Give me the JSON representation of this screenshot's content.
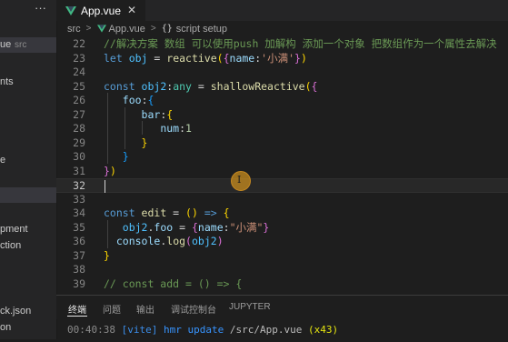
{
  "sidebar": {
    "menu_glyph": "···",
    "items": [
      {
        "label": "ue",
        "badge": "src"
      },
      {
        "label": "nts"
      },
      {
        "label": "e"
      },
      {
        "label": ""
      },
      {
        "label": "pment"
      },
      {
        "label": "ction"
      },
      {
        "label": "ck.json"
      },
      {
        "label": "on"
      }
    ]
  },
  "tab": {
    "label": "App.vue",
    "close_glyph": "✕",
    "icon": "vue-icon"
  },
  "breadcrumb": {
    "parts": [
      "src",
      "App.vue",
      "script setup"
    ],
    "separator": ">",
    "braces": "{}"
  },
  "editor": {
    "current_line": 32,
    "lines": [
      {
        "n": "22",
        "tokens": [
          [
            "cm",
            "//解决方案 数组 可以使用push 加解构 添加一个对象 把数组作为一个属性去解决"
          ]
        ]
      },
      {
        "n": "23",
        "tokens": [
          [
            "kw",
            "let "
          ],
          [
            "var",
            "obj"
          ],
          [
            "op",
            " = "
          ],
          [
            "fn",
            "reactive"
          ],
          [
            "b1",
            "("
          ],
          [
            "b2",
            "{"
          ],
          [
            "prop",
            "name"
          ],
          [
            "op",
            ":"
          ],
          [
            "str",
            "'小满'"
          ],
          [
            "b2",
            "}"
          ],
          [
            "b1",
            ")"
          ]
        ]
      },
      {
        "n": "24",
        "tokens": []
      },
      {
        "n": "25",
        "tokens": [
          [
            "kw",
            "const "
          ],
          [
            "var",
            "obj2"
          ],
          [
            "op",
            ":"
          ],
          [
            "type",
            "any"
          ],
          [
            "op",
            " = "
          ],
          [
            "fn",
            "shallowReactive"
          ],
          [
            "b1",
            "("
          ],
          [
            "b2",
            "{"
          ]
        ]
      },
      {
        "n": "26",
        "tokens": [
          [
            "op",
            "   "
          ],
          [
            "prop",
            "foo"
          ],
          [
            "op",
            ":"
          ],
          [
            "b3",
            "{"
          ]
        ]
      },
      {
        "n": "27",
        "tokens": [
          [
            "op",
            "      "
          ],
          [
            "prop",
            "bar"
          ],
          [
            "op",
            ":"
          ],
          [
            "b1",
            "{"
          ]
        ]
      },
      {
        "n": "28",
        "tokens": [
          [
            "op",
            "         "
          ],
          [
            "prop",
            "num"
          ],
          [
            "op",
            ":"
          ],
          [
            "num",
            "1"
          ]
        ]
      },
      {
        "n": "29",
        "tokens": [
          [
            "op",
            "      "
          ],
          [
            "b1",
            "}"
          ]
        ]
      },
      {
        "n": "30",
        "tokens": [
          [
            "op",
            "   "
          ],
          [
            "b3",
            "}"
          ]
        ]
      },
      {
        "n": "31",
        "tokens": [
          [
            "b2",
            "}"
          ],
          [
            "b1",
            ")"
          ]
        ]
      },
      {
        "n": "32",
        "tokens": []
      },
      {
        "n": "33",
        "tokens": []
      },
      {
        "n": "34",
        "tokens": [
          [
            "kw",
            "const "
          ],
          [
            "fn",
            "edit"
          ],
          [
            "op",
            " = "
          ],
          [
            "b1",
            "("
          ],
          [
            "b1",
            ")"
          ],
          [
            "kw",
            " => "
          ],
          [
            "b1",
            "{"
          ]
        ]
      },
      {
        "n": "35",
        "tokens": [
          [
            "op",
            "   "
          ],
          [
            "var",
            "obj2"
          ],
          [
            "op",
            "."
          ],
          [
            "prop",
            "foo"
          ],
          [
            "op",
            " = "
          ],
          [
            "b2",
            "{"
          ],
          [
            "prop",
            "name"
          ],
          [
            "op",
            ":"
          ],
          [
            "str",
            "\"小满\""
          ],
          [
            "b2",
            "}"
          ]
        ]
      },
      {
        "n": "36",
        "tokens": [
          [
            "op",
            "  "
          ],
          [
            "prop",
            "console"
          ],
          [
            "op",
            "."
          ],
          [
            "fn",
            "log"
          ],
          [
            "b2",
            "("
          ],
          [
            "var",
            "obj2"
          ],
          [
            "b2",
            ")"
          ]
        ]
      },
      {
        "n": "37",
        "tokens": [
          [
            "b1",
            "}"
          ]
        ]
      },
      {
        "n": "38",
        "tokens": []
      },
      {
        "n": "39",
        "tokens": [
          [
            "cm",
            "// const add = () => {"
          ]
        ]
      }
    ]
  },
  "panel": {
    "tabs": [
      "终端",
      "问题",
      "输出",
      "调试控制台",
      "JUPYTER"
    ],
    "active_tab": 0
  },
  "terminal": {
    "time": "00:40:38",
    "tag": "[vite]",
    "command": "hmr update",
    "path": "/src/App.vue",
    "count": "(x43)"
  },
  "colors": {
    "vue_green": "#41b883",
    "vue_dark": "#35495e",
    "cursor_highlight": "#c88a20"
  }
}
